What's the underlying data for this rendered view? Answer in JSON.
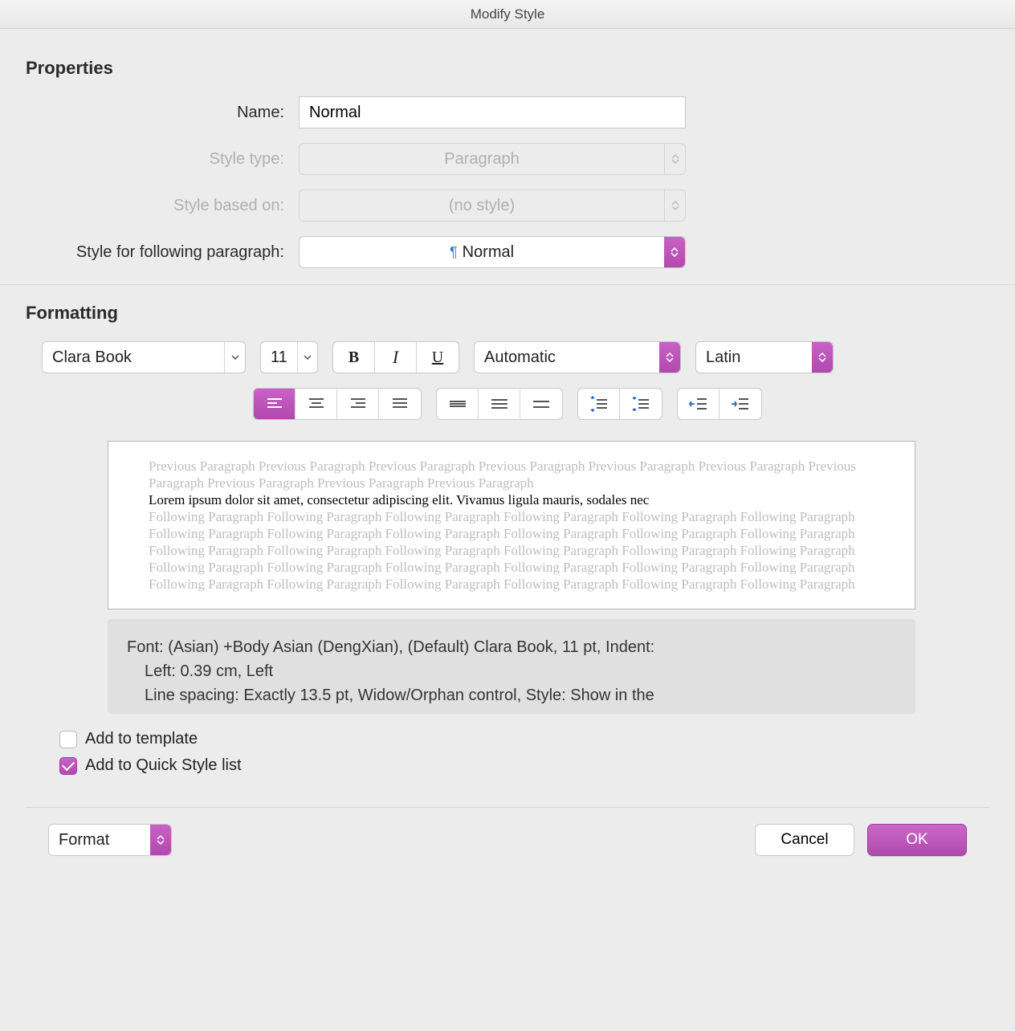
{
  "title": "Modify Style",
  "sections": {
    "properties": "Properties",
    "formatting": "Formatting"
  },
  "labels": {
    "name": "Name:",
    "style_type": "Style type:",
    "based_on": "Style based on:",
    "following": "Style for following paragraph:"
  },
  "fields": {
    "name": "Normal",
    "style_type": "Paragraph",
    "based_on": "(no style)",
    "following": "Normal"
  },
  "formatting": {
    "font": "Clara Book",
    "size": "11",
    "bold_label": "B",
    "italic_label": "I",
    "underline_label": "U",
    "color": "Automatic",
    "script": "Latin"
  },
  "preview": {
    "ghost_prev": "Previous Paragraph Previous Paragraph Previous Paragraph Previous Paragraph Previous Paragraph Previous Paragraph Previous Paragraph Previous Paragraph Previous Paragraph Previous Paragraph",
    "sample": "Lorem ipsum dolor sit amet, consectetur adipiscing elit. Vivamus ligula mauris, sodales nec",
    "ghost_next": "Following Paragraph Following Paragraph Following Paragraph Following Paragraph Following Paragraph Following Paragraph Following Paragraph Following Paragraph Following Paragraph Following Paragraph Following Paragraph Following Paragraph Following Paragraph Following Paragraph Following Paragraph Following Paragraph Following Paragraph Following Paragraph Following Paragraph Following Paragraph Following Paragraph Following Paragraph Following Paragraph Following Paragraph Following Paragraph Following Paragraph Following Paragraph Following Paragraph Following Paragraph Following Paragraph"
  },
  "description": {
    "line1": "Font: (Asian) +Body Asian (DengXian), (Default) Clara Book, 11 pt, Indent:",
    "line2": "Left:  0.39 cm, Left",
    "line3": "Line spacing:  Exactly 13.5 pt, Widow/Orphan control, Style: Show in the"
  },
  "checkboxes": {
    "add_template": "Add to template",
    "add_quick": "Add to Quick Style list"
  },
  "footer": {
    "format": "Format",
    "cancel": "Cancel",
    "ok": "OK"
  }
}
